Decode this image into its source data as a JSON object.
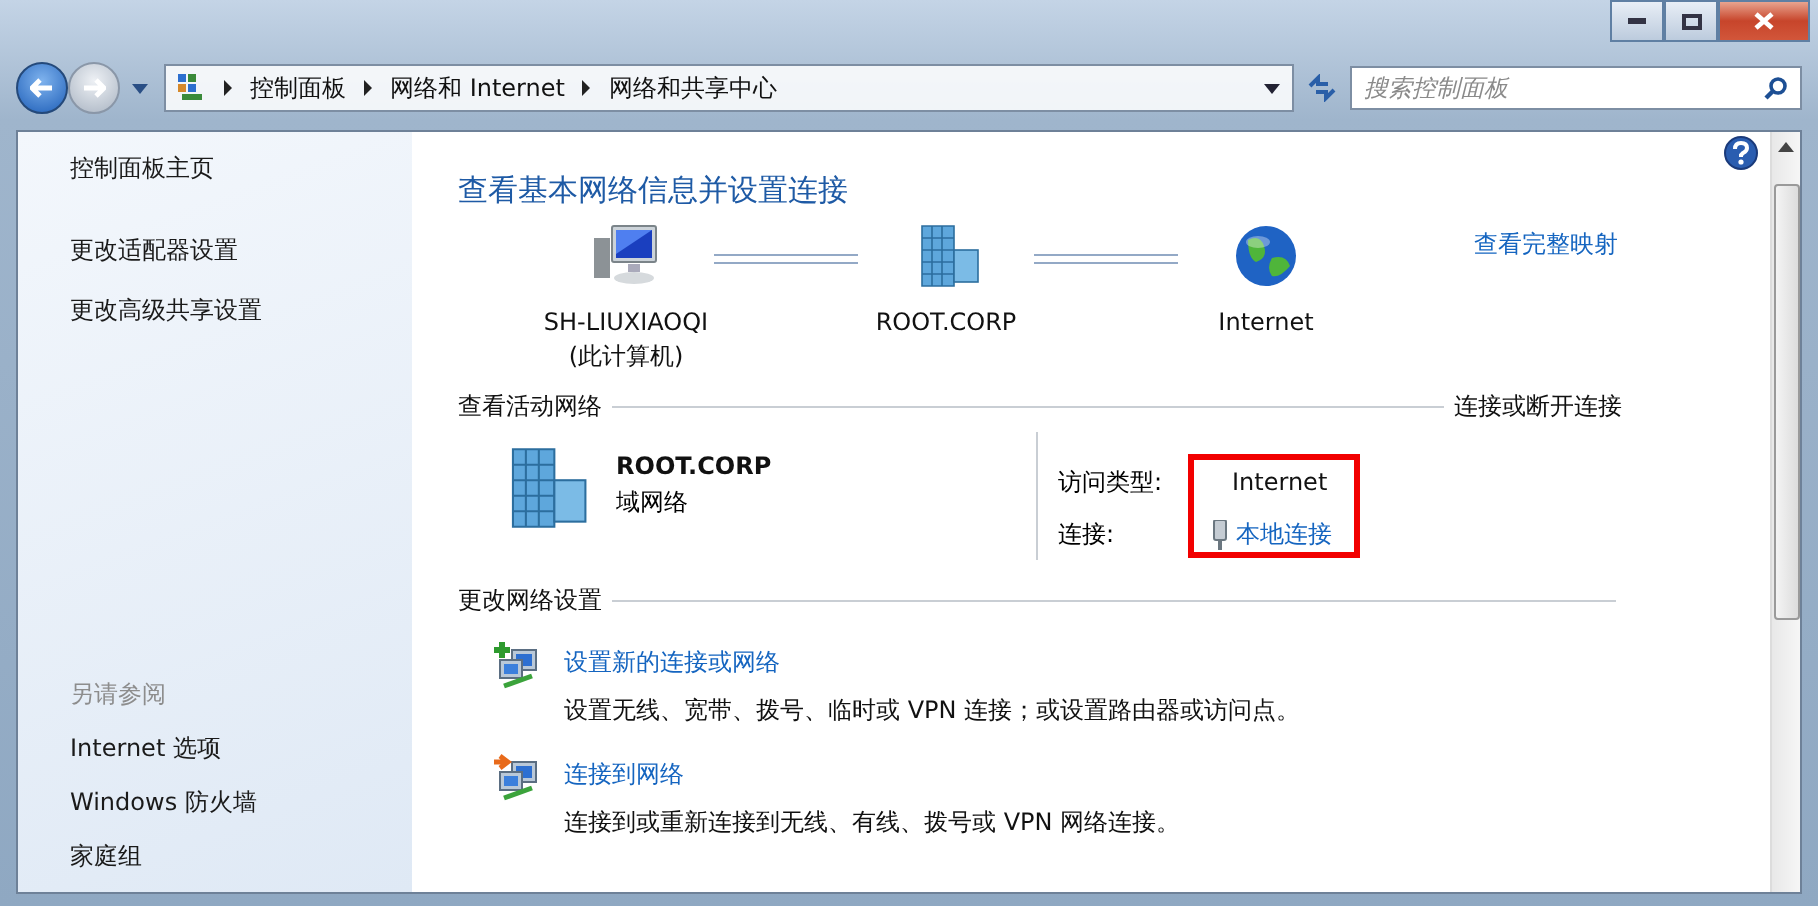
{
  "address_bar": {
    "breadcrumbs": [
      "控制面板",
      "网络和 Internet",
      "网络和共享中心"
    ]
  },
  "search": {
    "placeholder": "搜索控制面板"
  },
  "sidebar": {
    "links": [
      "控制面板主页",
      "更改适配器设置",
      "更改高级共享设置"
    ],
    "see_also": {
      "heading": "另请参阅",
      "links": [
        "Internet 选项",
        "Windows 防火墙",
        "家庭组"
      ]
    }
  },
  "main": {
    "title": "查看基本网络信息并设置连接",
    "map": {
      "nodes": [
        {
          "kind": "computer",
          "name": "SH-LIUXIAOQI",
          "note": "(此计算机)"
        },
        {
          "kind": "domain",
          "name": "ROOT.CORP"
        },
        {
          "kind": "internet",
          "name": "Internet"
        }
      ],
      "full_map_link": "查看完整映射"
    },
    "active_networks": {
      "heading": "查看活动网络",
      "link": "连接或断开连接",
      "network": {
        "name": "ROOT.CORP",
        "type": "域网络",
        "access_label": "访问类型:",
        "access_value": "Internet",
        "connection_label": "连接:",
        "connection_link": "本地连接",
        "highlighted": true
      }
    },
    "change_settings": {
      "heading": "更改网络设置",
      "tasks": [
        {
          "kind": "new",
          "title": "设置新的连接或网络",
          "description": "设置无线、宽带、拨号、临时或 VPN 连接；或设置路由器或访问点。"
        },
        {
          "kind": "connect",
          "title": "连接到网络",
          "description": "连接到或重新连接到无线、有线、拨号或 VPN 网络连接。"
        }
      ]
    }
  }
}
